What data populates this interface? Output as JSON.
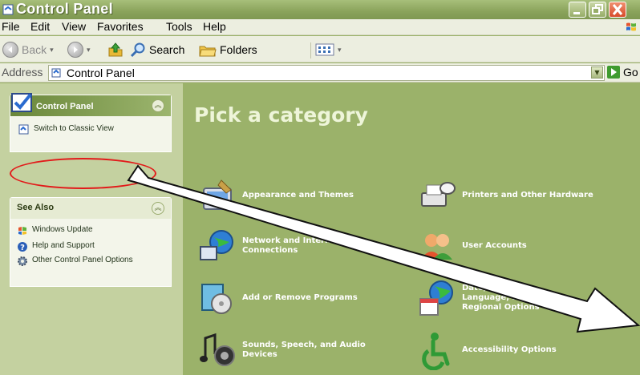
{
  "window": {
    "title": "Control Panel"
  },
  "menubar": {
    "items": [
      {
        "label": "File"
      },
      {
        "label": "Edit"
      },
      {
        "label": "View"
      },
      {
        "label": "Favorites"
      },
      {
        "label": "Tools"
      },
      {
        "label": "Help"
      }
    ]
  },
  "toolbar": {
    "back_label": "Back",
    "search_label": "Search",
    "folders_label": "Folders"
  },
  "address": {
    "label": "Address",
    "value": "Control Panel",
    "go_label": "Go"
  },
  "sidebar": {
    "cp_title": "Control Panel",
    "switch_link": "Switch to Classic View",
    "see_also_title": "See Also",
    "see_also": [
      {
        "label": "Windows Update"
      },
      {
        "label": "Help and Support"
      },
      {
        "label": "Other Control Panel Options"
      }
    ]
  },
  "main": {
    "heading": "Pick a category",
    "categories": [
      {
        "label": "Appearance and Themes",
        "icon": "appearance-icon"
      },
      {
        "label": "Printers and Other Hardware",
        "icon": "printer-icon"
      },
      {
        "label": "Network and Internet Connections",
        "icon": "network-icon"
      },
      {
        "label": "User Accounts",
        "icon": "user-accounts-icon"
      },
      {
        "label": "Add or Remove Programs",
        "icon": "add-remove-icon"
      },
      {
        "label": "Date, Time, Language, and Regional Options",
        "icon": "date-time-icon"
      },
      {
        "label": "Sounds, Speech, and Audio Devices",
        "icon": "sounds-icon"
      },
      {
        "label": "Accessibility Options",
        "icon": "accessibility-icon"
      }
    ]
  },
  "colors": {
    "main_bg": "#9bb26a",
    "annotation_red": "#e21a1a"
  }
}
